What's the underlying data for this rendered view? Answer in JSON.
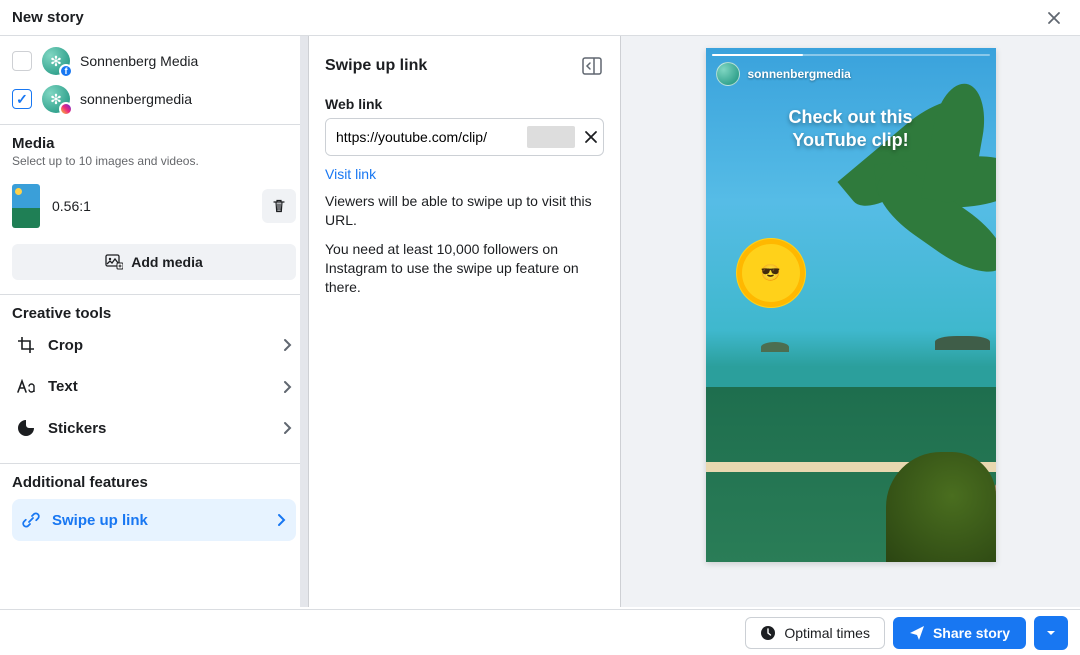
{
  "header": {
    "title": "New story"
  },
  "accounts": [
    {
      "name": "Sonnenberg Media",
      "platform": "fb",
      "checked": false
    },
    {
      "name": "sonnenbergmedia",
      "platform": "ig",
      "checked": true
    }
  ],
  "media": {
    "title": "Media",
    "subtitle": "Select up to 10 images and videos.",
    "items": [
      {
        "ratio": "0.56:1"
      }
    ],
    "add_label": "Add media"
  },
  "creative": {
    "title": "Creative tools",
    "items": [
      {
        "key": "crop",
        "label": "Crop"
      },
      {
        "key": "text",
        "label": "Text"
      },
      {
        "key": "stickers",
        "label": "Stickers"
      }
    ]
  },
  "additional": {
    "title": "Additional features",
    "swipe_label": "Swipe up link"
  },
  "swipe_panel": {
    "title": "Swipe up link",
    "field_label": "Web link",
    "url_value": "https://youtube.com/clip/",
    "visit_label": "Visit link",
    "help1": "Viewers will be able to swipe up to visit this URL.",
    "help2": "You need at least 10,000 followers on Instagram to use the swipe up feature on there."
  },
  "preview": {
    "username": "sonnenbergmedia",
    "overlay_text": "Check out this\nYouTube clip!"
  },
  "footer": {
    "optimal_label": "Optimal times",
    "share_label": "Share story"
  }
}
